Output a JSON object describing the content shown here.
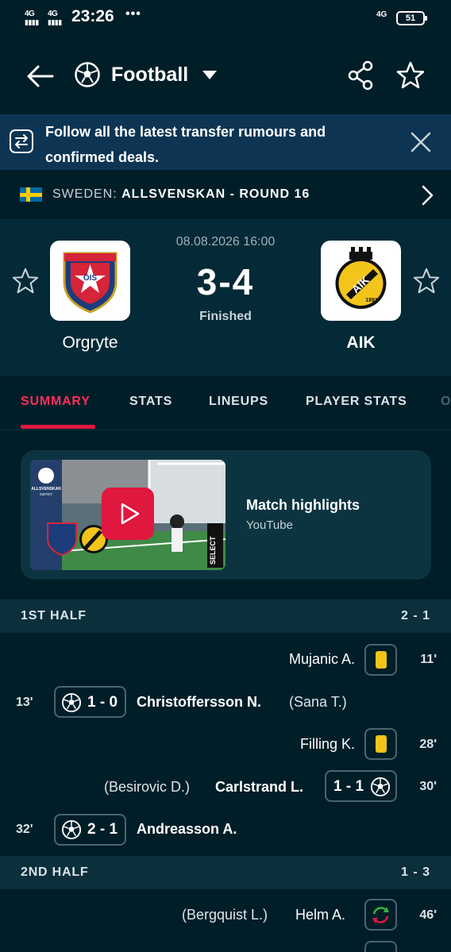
{
  "status_bar": {
    "signal_1": "4G",
    "signal_2": "4G",
    "time": "23:26",
    "dots": "•••",
    "network": "4G",
    "battery": "51"
  },
  "header": {
    "sport": "Football",
    "icons": [
      "back-arrow-icon",
      "football-icon",
      "chevron-down-icon",
      "share-icon",
      "star-icon"
    ]
  },
  "banner": {
    "text": "Follow all the latest transfer rumours and confirmed deals."
  },
  "league": {
    "country": "SWEDEN:",
    "competition": "ALLSVENSKAN - ROUND 16"
  },
  "match": {
    "date": "08.08.2026 16:00",
    "score": "3-4",
    "status": "Finished",
    "home": {
      "name": "Orgryte",
      "crest_text": "ÖIS"
    },
    "away": {
      "name": "AIK",
      "crest_text": "AIK",
      "crest_year": "1891"
    }
  },
  "tabs": [
    {
      "label": "SUMMARY",
      "active": true
    },
    {
      "label": "STATS",
      "active": false
    },
    {
      "label": "LINEUPS",
      "active": false
    },
    {
      "label": "PLAYER STATS",
      "active": false
    },
    {
      "label": "O",
      "active": false
    }
  ],
  "highlights": {
    "title": "Match highlights",
    "source": "YouTube",
    "thumb_badge": "ALLSVENSKAN",
    "thumb_badge_sub": "SMITET",
    "thumb_brand": "SELECT"
  },
  "halves": [
    {
      "label": "1ST HALF",
      "score": "2 - 1"
    },
    {
      "label": "2ND HALF",
      "score": "1 - 3"
    }
  ],
  "events": [
    {
      "minute": "11'",
      "side": "away",
      "type": "yellow-card",
      "player": "Mujanic A.",
      "assist": "",
      "score": ""
    },
    {
      "minute": "13'",
      "side": "home",
      "type": "goal",
      "player": "Christoffersson N.",
      "assist": "(Sana T.)",
      "score": "1 - 0"
    },
    {
      "minute": "28'",
      "side": "away",
      "type": "yellow-card",
      "player": "Filling K.",
      "assist": "",
      "score": ""
    },
    {
      "minute": "30'",
      "side": "away",
      "type": "goal",
      "player": "Carlstrand L.",
      "assist": "(Besirovic D.)",
      "score": "1 - 1"
    },
    {
      "minute": "32'",
      "side": "home",
      "type": "goal",
      "player": "Andreasson A.",
      "assist": "",
      "score": "2 - 1"
    },
    {
      "minute": "46'",
      "side": "away",
      "type": "substitution",
      "player": "Helm A.",
      "assist": "(Bergquist L.)",
      "score": ""
    }
  ],
  "colors": {
    "background": "#001e28",
    "banner": "#0d3553",
    "accent": "#e0173e",
    "yellow_card": "#f4c318"
  }
}
